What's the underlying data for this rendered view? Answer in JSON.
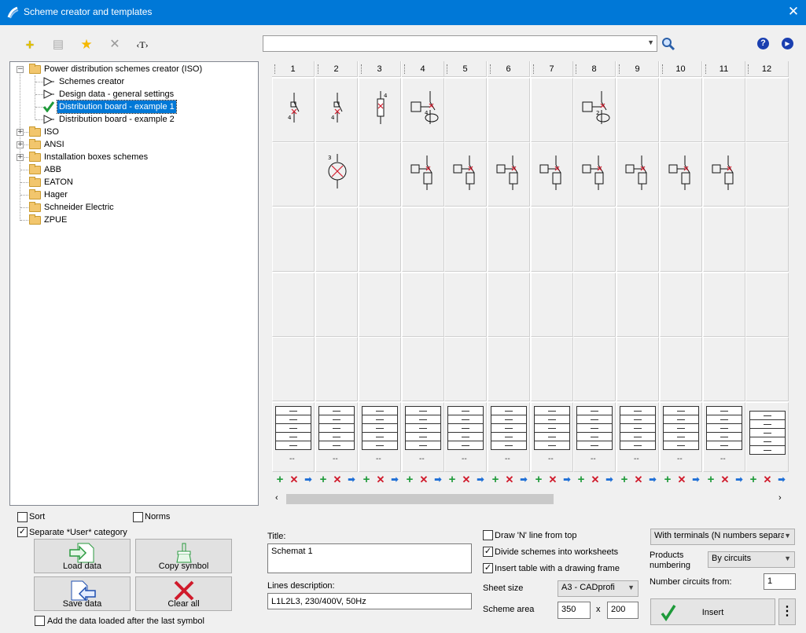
{
  "window": {
    "title": "Scheme creator and templates",
    "close": "✕"
  },
  "toolbar": {
    "add": "+",
    "props": "▤",
    "fav": "★",
    "del": "✕",
    "text": "‹T›",
    "search_value": "",
    "help": "?",
    "next": "▶"
  },
  "tree": {
    "root": "Power distribution schemes creator (ISO)",
    "children": [
      "Schemes creator",
      "Design data - general settings",
      "Distribution board - example 1",
      "Distribution board - example 2"
    ],
    "selected": "Distribution board - example 1",
    "folders": [
      "ISO",
      "ANSI",
      "Installation boxes schemes",
      "ABB",
      "EATON",
      "Hager",
      "Schneider Electric",
      "ZPUE"
    ]
  },
  "grid": {
    "columns": [
      "1",
      "2",
      "3",
      "4",
      "5",
      "6",
      "7",
      "8",
      "9",
      "10",
      "11",
      "12"
    ],
    "row1": [
      "breaker",
      "breaker",
      "fuse",
      "rcd",
      "",
      "",
      "",
      "rcd2",
      "",
      "",
      "",
      ""
    ],
    "row2": [
      "",
      "lamp",
      "",
      "mcb",
      "mcb",
      "mcb",
      "mcb",
      "mcb",
      "mcb",
      "mcb",
      "mcb",
      ""
    ],
    "table_dash": "--"
  },
  "options": {
    "sort": "Sort",
    "norms": "Norms",
    "separate": "Separate *User* category",
    "load_data": "Load data",
    "copy_symbol": "Copy symbol",
    "save_data": "Save data",
    "clear_all": "Clear all",
    "add_after_last": "Add the data loaded after the last symbol"
  },
  "form": {
    "title_label": "Title:",
    "title_value": "Schemat 1",
    "lines_label": "Lines description:",
    "lines_value": "L1L2L3, 230/400V, 50Hz",
    "draw_n": "Draw 'N' line from top",
    "divide": "Divide schemes into worksheets",
    "insert_table": "Insert table with a drawing frame",
    "sheet_size_label": "Sheet size",
    "sheet_size_value": "A3 - CADprofi",
    "scheme_area_label": "Scheme area",
    "area_w": "350",
    "area_x": "x",
    "area_h": "200",
    "terminals_value": "With terminals (N numbers separa",
    "products_numbering_label": "Products numbering",
    "products_numbering_value": "By circuits",
    "number_from_label": "Number circuits from:",
    "number_from_value": "1",
    "insert_button": "Insert",
    "more": "⋮"
  },
  "checks": {
    "sort": false,
    "norms": false,
    "separate": true,
    "add_after_last": false,
    "draw_n": false,
    "divide": true,
    "insert_table": true
  },
  "colors": {
    "titlebar": "#0078d7",
    "selection": "#0078d7",
    "plus": "#1e9a3a",
    "x": "#d01a2b",
    "arrow": "#1f6fd6",
    "fav": "#f5b800"
  }
}
